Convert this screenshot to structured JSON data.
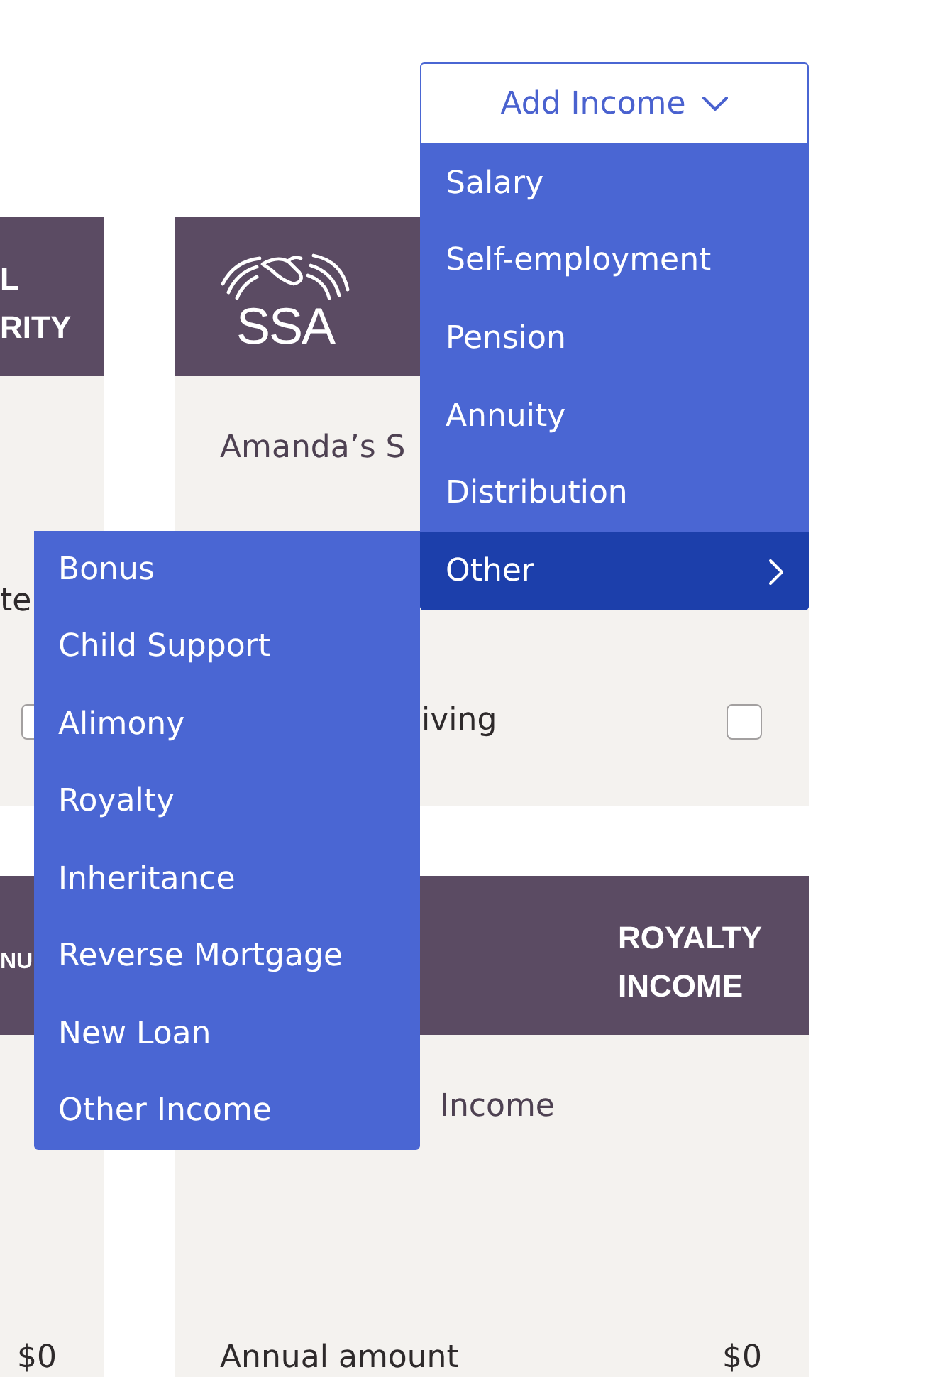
{
  "add_income": {
    "label": "Add Income",
    "expanded": true,
    "menu": [
      {
        "label": "Salary",
        "selected": false,
        "has_submenu": false
      },
      {
        "label": "Self-employment",
        "selected": false,
        "has_submenu": false
      },
      {
        "label": "Pension",
        "selected": false,
        "has_submenu": false
      },
      {
        "label": "Annuity",
        "selected": false,
        "has_submenu": false
      },
      {
        "label": "Distribution",
        "selected": false,
        "has_submenu": false
      },
      {
        "label": "Other",
        "selected": true,
        "has_submenu": true
      }
    ],
    "submenu": [
      {
        "label": "Bonus",
        "selected": false
      },
      {
        "label": "Child Support",
        "selected": false
      },
      {
        "label": "Alimony",
        "selected": false
      },
      {
        "label": "Royalty",
        "selected": false
      },
      {
        "label": "Inheritance",
        "selected": false
      },
      {
        "label": "Reverse Mortgage",
        "selected": false
      },
      {
        "label": "New Loan",
        "selected": false
      },
      {
        "label": "Other Income",
        "selected": false
      }
    ]
  },
  "card_rows": [
    [
      {
        "header": {
          "kind": "title",
          "lines": [
            "L",
            "RITY"
          ]
        },
        "heading": "te",
        "option": {
          "checked": false
        }
      },
      {
        "header": {
          "kind": "logo",
          "text": "SSA"
        },
        "name": "Amanda’s S",
        "option": {
          "label": "iving",
          "checked": false
        }
      }
    ],
    [
      {
        "header": {
          "kind": "title",
          "lines": [
            "NU"
          ]
        },
        "amount": "$0"
      },
      {
        "header": {
          "kind": "title",
          "lines": [
            "ROYALTY",
            "INCOME"
          ]
        },
        "name": "Income",
        "amount_label": "Annual amount",
        "amount": "$0"
      }
    ]
  ]
}
